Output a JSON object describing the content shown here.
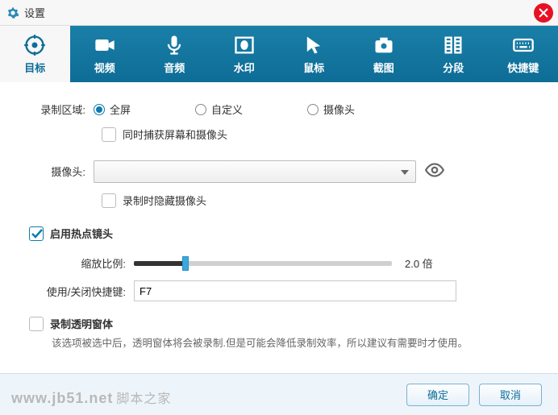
{
  "window": {
    "title": "设置"
  },
  "tabs": [
    {
      "label": "目标"
    },
    {
      "label": "视频"
    },
    {
      "label": "音频"
    },
    {
      "label": "水印"
    },
    {
      "label": "鼠标"
    },
    {
      "label": "截图"
    },
    {
      "label": "分段"
    },
    {
      "label": "快捷键"
    }
  ],
  "form": {
    "area_label": "录制区域:",
    "area_options": {
      "full": "全屏",
      "custom": "自定义",
      "camera": "摄像头"
    },
    "capture_both": "同时捕获屏幕和摄像头",
    "camera_label": "摄像头:",
    "hide_camera_label": "录制时隐藏摄像头",
    "enable_hotspot": "启用热点镜头",
    "zoom_label": "缩放比例:",
    "zoom_value": "2.0 倍",
    "hotkey_label": "使用/关闭快捷键:",
    "hotkey_value": "F7",
    "transparent_label": "录制透明窗体",
    "transparent_hint": "该选项被选中后，透明窗体将会被录制.但是可能会降低录制效率，所以建议有需要时才使用。"
  },
  "footer": {
    "ok": "确定",
    "cancel": "取消"
  },
  "watermark": {
    "url": "www.jb51.net",
    "name": "脚本之家"
  }
}
